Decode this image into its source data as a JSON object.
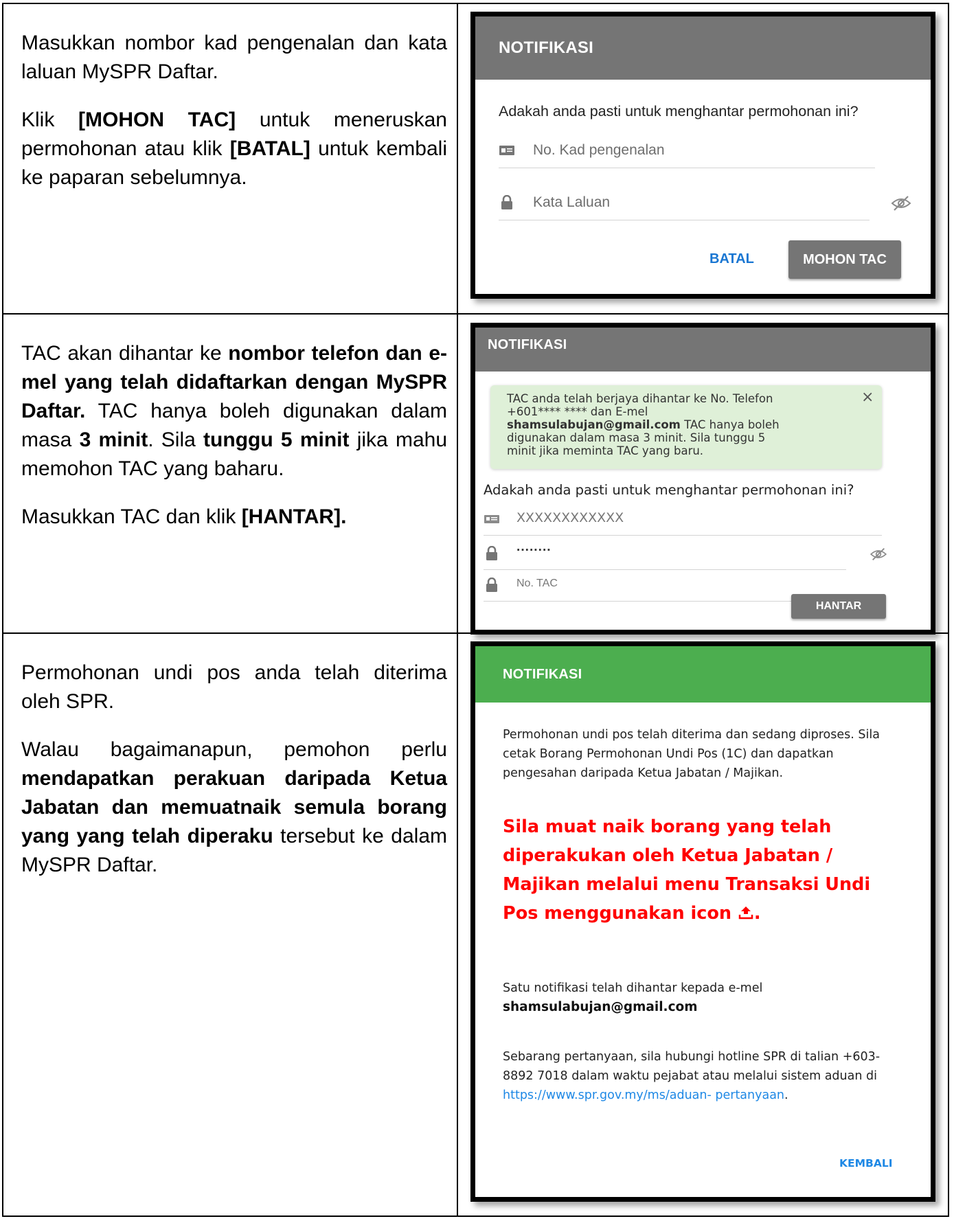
{
  "row1": {
    "left": {
      "p1": "Masukkan nombor kad pengenalan dan kata laluan MySPR Daftar.",
      "p2_a": "Klik ",
      "p2_b": "[MOHON TAC]",
      "p2_c": " untuk meneruskan permohonan atau klik ",
      "p2_d": "[BATAL]",
      "p2_e": " untuk kembali ke paparan sebelumnya."
    },
    "dialog": {
      "header": "NOTIFIKASI",
      "question": "Adakah anda pasti untuk menghantar permohonan ini?",
      "ic_placeholder": "No. Kad pengenalan",
      "password_placeholder": "Kata Laluan",
      "cancel_label": "BATAL",
      "submit_label": "MOHON TAC",
      "icons": {
        "ic": "id-card-icon",
        "password": "lock-icon",
        "visibility": "eye-off-icon"
      }
    }
  },
  "row2": {
    "left": {
      "p1_a": "TAC akan dihantar ke ",
      "p1_b": "nombor telefon dan e-mel yang telah didaftarkan dengan MySPR Daftar.",
      "p1_c": " TAC hanya boleh digunakan dalam masa ",
      "p1_d": "3 minit",
      "p1_e": ". Sila ",
      "p1_f": "tunggu 5 minit",
      "p1_g": " jika mahu memohon TAC yang baharu.",
      "p2_a": "Masukkan TAC dan klik ",
      "p2_b": "[HANTAR]."
    },
    "dialog": {
      "header": "NOTIFIKASI",
      "alert_line1": "TAC anda telah berjaya dihantar ke No. Telefon",
      "alert_line2": "+601**** ****  dan E-mel",
      "alert_email": "shamsulabujan@gmail.com",
      "alert_line3_rest": " TAC hanya boleh",
      "alert_line4": "digunakan dalam masa 3 minit. Sila tunggu 5",
      "alert_line5": "minit jika meminta TAC yang baru.",
      "alert_close": "×",
      "question": "Adakah anda pasti untuk menghantar permohonan ini?",
      "ic_value": "XXXXXXXXXXXX",
      "password_value": "········",
      "tac_placeholder": "No. TAC",
      "submit_label": "HANTAR",
      "icons": {
        "ic": "id-card-icon",
        "password": "lock-icon",
        "tac": "lock-icon",
        "visibility": "eye-off-icon"
      }
    }
  },
  "row3": {
    "left": {
      "p1": "Permohonan undi pos anda telah diterima oleh SPR.",
      "p2_a": "Walau bagaimanapun, pemohon perlu ",
      "p2_b": "mendapatkan perakuan daripada Ketua Jabatan dan memuatnaik semula borang yang yang telah diperaku",
      "p2_c": " tersebut ke dalam MySPR Daftar."
    },
    "dialog": {
      "header": "NOTIFIKASI",
      "body1": "Permohonan undi pos telah diterima dan sedang diproses. Sila cetak Borang Permohonan Undi Pos (1C) dan dapatkan pengesahan daripada Ketua Jabatan / Majikan.",
      "red_line1": "Sila muat naik borang yang telah",
      "red_line2": "diperakukan oleh Ketua Jabatan /",
      "red_line3": "Majikan melalui menu Transaksi Undi",
      "red_line4_text": "Pos menggunakan icon ",
      "red_line4_end": ".",
      "notif_line": "Satu notifikasi telah dihantar kepada e-mel",
      "notif_email": "shamsulabujan@gmail.com",
      "contact_text": "Sebarang pertanyaan, sila hubungi hotline SPR di talian +603-8892 7018 dalam waktu pejabat atau melalui sistem aduan di ",
      "contact_link_1": "https://www.spr.gov.my/ms/aduan-",
      "contact_link_2": "pertanyaan",
      "contact_end": ".",
      "back_label": "KEMBALI",
      "icons": {
        "upload": "upload-icon"
      },
      "colors": {
        "header": "#4cae4f",
        "warning": "#ff0000",
        "link": "#1e88e5"
      }
    }
  }
}
